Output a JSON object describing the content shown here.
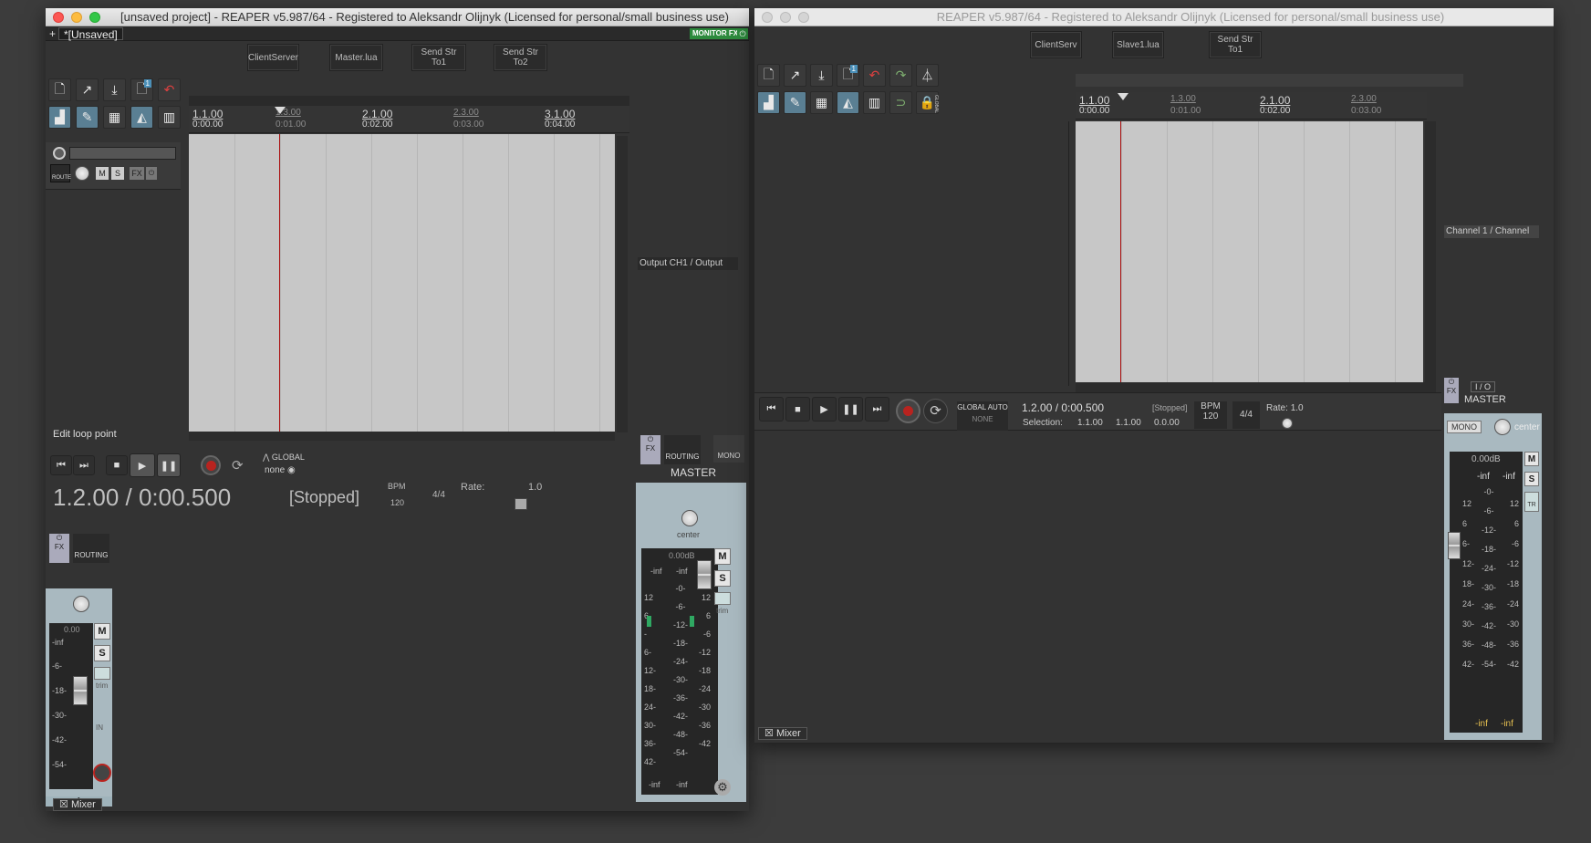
{
  "left_window": {
    "title": "[unsaved project] - REAPER v5.987/64 - Registered to Aleksandr Olijnyk (Licensed for personal/small business use)",
    "project_tab": "*[Unsaved]",
    "tab_add": "+",
    "monitor_fx": "MONITOR FX",
    "script_buttons": [
      {
        "l1": "ClientServer",
        "l2": ""
      },
      {
        "l1": "Master.lua",
        "l2": ""
      },
      {
        "l1": "Send Str",
        "l2": "To1"
      },
      {
        "l1": "Send Str",
        "l2": "To2"
      }
    ],
    "toolbar_badge": "1",
    "ruler": {
      "m1": "1.1.00",
      "t1": "0:00.00",
      "m2": "1.3.00",
      "t2": "0:01.00",
      "m3": "2.1.00",
      "t3": "0:02.00",
      "m4": "2.3.00",
      "t4": "0:03.00",
      "m5": "3.1.00",
      "t5": "0:04.00"
    },
    "track": {
      "route": "ROUTE",
      "m": "M",
      "s": "S",
      "fx": "FX"
    },
    "status_text": "Edit loop point",
    "transport": {
      "position": "1.2.00 / 0:00.500",
      "state": "[Stopped]",
      "bpm_label": "BPM",
      "bpm": "120",
      "timesig": "4/4",
      "rate_label": "Rate:",
      "rate": "1.0",
      "global_label": "GLOBAL",
      "global_value": "none"
    },
    "master_io": {
      "output": "Output CH1 / Output",
      "fx": "FX",
      "routing": "ROUTING",
      "mono": "MONO",
      "m": "M",
      "s": "S"
    },
    "master": {
      "label": "MASTER",
      "pan": "center",
      "db": "0.00dB",
      "peak_l": "-inf",
      "peak_r": "-inf",
      "m": "M",
      "s": "S",
      "trim": "trim",
      "scale_left": [
        "-0-",
        "-6-",
        "-12-",
        "-18-",
        "-24-",
        "-30-",
        "-36-",
        "-42-",
        "-48-",
        "-54-"
      ],
      "scale_l": [
        "12",
        "6",
        "-",
        "6-",
        "12-",
        "18-",
        "24-",
        "30-",
        "36-",
        "42-"
      ],
      "scale_r": [
        "12",
        "6",
        "-6",
        "-12",
        "-18",
        "-24",
        "-30",
        "-36",
        "-42"
      ],
      "bottom_l": "-inf",
      "bottom_r": "-inf"
    },
    "track_strip": {
      "fx": "FX",
      "routing": "ROUTING",
      "db": "0.00",
      "peak": "-inf",
      "m": "M",
      "s": "S",
      "trim": "trim",
      "in": "IN",
      "scale": [
        "-6-",
        "-18-",
        "-30-",
        "-42-",
        "-54-"
      ],
      "number": "1"
    },
    "mixer_tab": "Mixer"
  },
  "right_window": {
    "title": "REAPER v5.987/64 - Registered to Aleksandr Olijnyk (Licensed for personal/small business use)",
    "script_buttons": [
      {
        "l1": "ClientServ",
        "l2": ""
      },
      {
        "l1": "Slave1.lua",
        "l2": ""
      },
      {
        "l1": "Send Str",
        "l2": "To1"
      }
    ],
    "toolbar_badge": "1",
    "global_lock": "GLOBAL",
    "ruler": {
      "m1": "1.1.00",
      "t1": "0:00.00",
      "m2": "1.3.00",
      "t2": "0:01.00",
      "m3": "2.1.00",
      "t3": "0:02.00",
      "m4": "2.3.00",
      "t4": "0:03.00"
    },
    "transport": {
      "global_auto": "GLOBAL AUTO",
      "global_none": "NONE",
      "position": "1.2.00 / 0:00.500",
      "state": "[Stopped]",
      "selection_label": "Selection:",
      "sel_start": "1.1.00",
      "sel_end": "1.1.00",
      "sel_len": "0.0.00",
      "bpm_label": "BPM",
      "bpm": "120",
      "timesig": "4/4",
      "rate_label": "Rate:",
      "rate": "1.0"
    },
    "master": {
      "channel": "Channel 1 / Channel",
      "io": "I / O",
      "fx": "FX",
      "label": "MASTER",
      "mono": "MONO",
      "pan": "center",
      "db": "0.00dB",
      "peak_l": "-inf",
      "peak_r": "-inf",
      "m": "M",
      "s": "S",
      "tr": "TR",
      "scale_c": [
        "-0-",
        "-6-",
        "-12-",
        "-18-",
        "-24-",
        "-30-",
        "-36-",
        "-42-",
        "-48-",
        "-54-"
      ],
      "scale_l": [
        "12",
        "6",
        "6-",
        "12-",
        "18-",
        "24-",
        "30-",
        "36-",
        "42-"
      ],
      "scale_r": [
        "12",
        "6",
        "-6",
        "-12",
        "-18",
        "-24",
        "-30",
        "-36",
        "-42"
      ],
      "bottom_l": "-inf",
      "bottom_r": "-inf"
    },
    "mixer_tab": "Mixer"
  }
}
